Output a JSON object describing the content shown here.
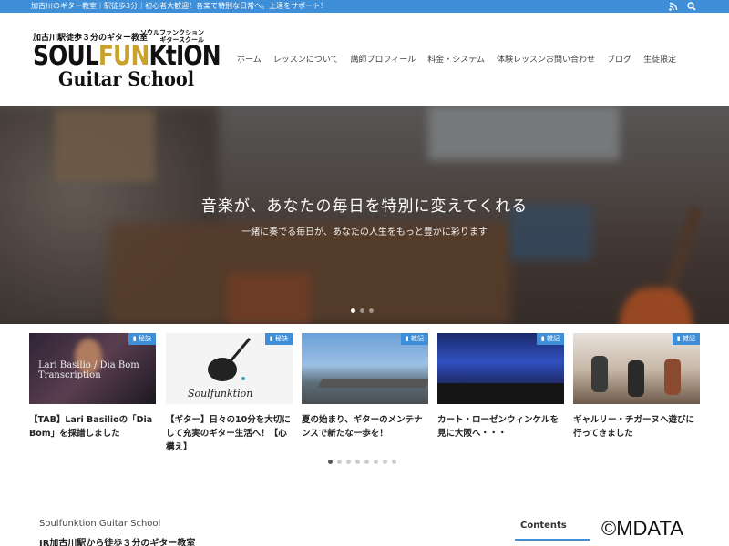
{
  "topbar": {
    "tagline": "加古川のギター教室｜駅徒歩3分｜初心者大歓迎！音楽で特別な日常へ。上達をサポート！",
    "icons": [
      "rss-icon",
      "search-icon"
    ]
  },
  "logo": {
    "line1": "加古川駅徒歩３分のギター教室",
    "katakana": "ソウルファンクション ギタースクール",
    "brand_a": "SOUL",
    "brand_b": "FUN",
    "brand_c": "KtION",
    "sub": "Guitar School"
  },
  "nav": {
    "items": [
      "ホーム",
      "レッスンについて",
      "講師プロフィール",
      "料金・システム",
      "体験レッスンお問い合わせ",
      "ブログ",
      "生徒限定"
    ]
  },
  "hero": {
    "heading": "音楽が、あなたの毎日を特別に変えてくれる",
    "subheading": "一緒に奏でる毎日が、あなたの人生をもっと豊かに彩ります"
  },
  "cards": [
    {
      "badge": "秘訣",
      "title": "【TAB】Lari Basilioの「Dia Bom」を採譜しました",
      "thumb_text": "Lari Basilio / Dia Bom Transcription"
    },
    {
      "badge": "秘訣",
      "title": "【ギター】日々の10分を大切にして充実のギター生活へ！【心構え】",
      "thumb_text": "Soulfunktion"
    },
    {
      "badge": "雑記",
      "title": "夏の始まり、ギターのメンテナンスで新たな一歩を！",
      "thumb_text": ""
    },
    {
      "badge": "雑記",
      "title": "カート・ローゼンウィンケルを見に大阪へ・・・",
      "thumb_text": ""
    },
    {
      "badge": "雑記",
      "title": "ギャルリー・チガーヌへ遊びに行ってきました",
      "thumb_text": ""
    }
  ],
  "footer": {
    "site_name": "Soulfunktion Guitar School",
    "site_desc": "JR加古川駅から徒歩３分のギター教室",
    "contents_label": "Contents"
  },
  "watermark": "©MDATA"
}
